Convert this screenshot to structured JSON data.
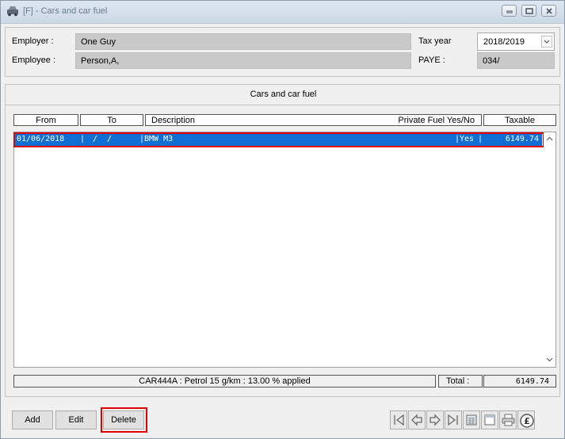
{
  "window": {
    "title": "[F] - Cars and car fuel",
    "icon": "car-icon",
    "controls": [
      "minimize-icon",
      "maximize-icon",
      "close-icon"
    ]
  },
  "employer": {
    "label": "Employer :",
    "value": "One Guy"
  },
  "employee": {
    "label": "Employee :",
    "value": "Person,A,"
  },
  "tax_year": {
    "label": "Tax year",
    "value": "2018/2019"
  },
  "paye": {
    "label": "PAYE :",
    "value": "034/"
  },
  "section": {
    "title": "Cars and car fuel"
  },
  "columns": {
    "from": "From",
    "to": "To",
    "description": "Description",
    "private_fuel": "Private Fuel Yes/No",
    "taxable": "Taxable"
  },
  "rows": [
    {
      "from": "01/06/2018",
      "to": "/  /",
      "description": "BMW M3",
      "private_fuel": "Yes",
      "taxable": "6149.74"
    }
  ],
  "status": {
    "summary": "CAR444A : Petrol 15 g/km : 13.00 % applied",
    "total_label": "Total :",
    "total_value": "6149.74"
  },
  "buttons": {
    "add": "Add",
    "edit": "Edit",
    "delete": "Delete"
  },
  "toolbar_icons": [
    "first-record-icon",
    "previous-record-icon",
    "next-record-icon",
    "last-record-icon",
    "calculator-icon",
    "notes-icon",
    "print-icon",
    "pound-icon"
  ],
  "colors": {
    "selection": "#0f6fd4",
    "highlight": "#e00000",
    "field_bg": "#c9c9c9"
  }
}
